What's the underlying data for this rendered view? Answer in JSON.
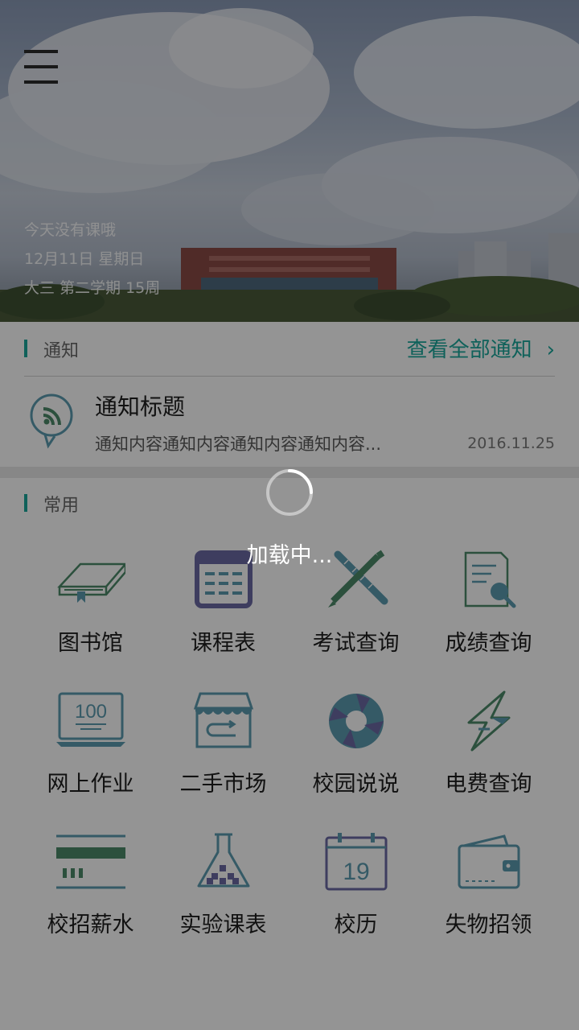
{
  "hero": {
    "status_line1": "今天没有课哦",
    "status_line2": "12月11日 星期日",
    "status_line3": "大三 第二学期 15周"
  },
  "notice_section": {
    "title": "通知",
    "view_all_label": "查看全部通知",
    "item": {
      "title": "通知标题",
      "body": "通知内容通知内容通知内容通知内容...",
      "date": "2016.11.25"
    }
  },
  "common_section": {
    "title": "常用",
    "items": [
      {
        "label": "图书馆",
        "icon": "book-icon"
      },
      {
        "label": "课程表",
        "icon": "schedule-icon"
      },
      {
        "label": "考试查询",
        "icon": "exam-icon"
      },
      {
        "label": "成绩查询",
        "icon": "grades-icon"
      },
      {
        "label": "网上作业",
        "icon": "homework-icon"
      },
      {
        "label": "二手市场",
        "icon": "market-icon"
      },
      {
        "label": "校园说说",
        "icon": "campus-talk-icon"
      },
      {
        "label": "电费查询",
        "icon": "electricity-icon"
      },
      {
        "label": "校招薪水",
        "icon": "salary-icon"
      },
      {
        "label": "实验课表",
        "icon": "lab-flask-icon"
      },
      {
        "label": "校历",
        "icon": "calendar-icon"
      },
      {
        "label": "失物招领",
        "icon": "wallet-icon"
      }
    ],
    "icon_texts": {
      "homework": "100",
      "calendar": "19"
    }
  },
  "overlay": {
    "loading_text": "加载中..."
  },
  "colors": {
    "accent": "#1aa89b",
    "icon_green": "#4d8a6a",
    "icon_purple": "#6b6aa4",
    "icon_blue": "#5c9cb0"
  }
}
